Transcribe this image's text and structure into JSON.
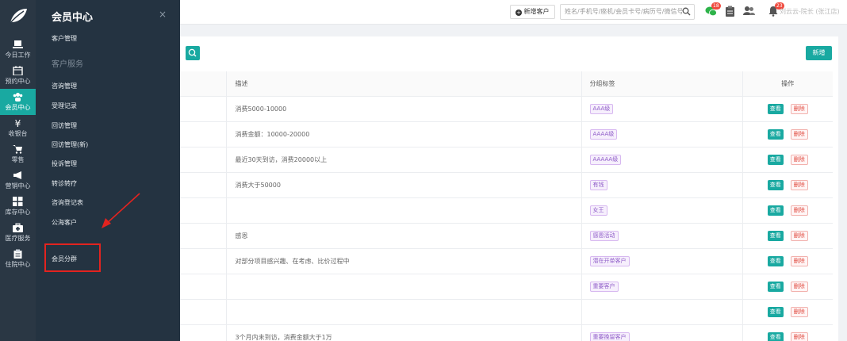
{
  "rail": [
    {
      "label": "今日工作",
      "icon": "laptop-icon"
    },
    {
      "label": "预约中心",
      "icon": "calendar-icon"
    },
    {
      "label": "会员中心",
      "icon": "users-icon",
      "active": true
    },
    {
      "label": "收银台",
      "icon": "yen-icon"
    },
    {
      "label": "零售",
      "icon": "cart-icon"
    },
    {
      "label": "营销中心",
      "icon": "megaphone-icon"
    },
    {
      "label": "库存中心",
      "icon": "grid-icon"
    },
    {
      "label": "医疗服务",
      "icon": "medkit-icon"
    },
    {
      "label": "住院中心",
      "icon": "clipboard-icon"
    }
  ],
  "flyout": {
    "title": "会员中心",
    "close": "×",
    "item_customer_mgmt": "客户管理",
    "section_service": "客户服务",
    "items": [
      "咨询管理",
      "受理记录",
      "回访管理",
      "回访管理(新)",
      "投诉管理",
      "转诊转疗",
      "咨询登记表",
      "公海客户"
    ],
    "item_member_group": "会员分群"
  },
  "header": {
    "add_customer": "新增客户",
    "search_placeholder": "姓名/手机号/座机/会员卡号/病历号/微信号",
    "badge_messages": "18",
    "badge_notifications": "23",
    "user": "刘云云-院长 (张江店)"
  },
  "toolbar": {
    "new_label": "新增"
  },
  "table": {
    "headers": [
      "",
      "描述",
      "分组标签",
      "操作"
    ],
    "rows": [
      {
        "desc": "消费5000-10000",
        "tag": "AAA级"
      },
      {
        "desc": "消费金额：10000-20000",
        "tag": "AAAA级"
      },
      {
        "desc": "最近30天到访，消费20000以上",
        "tag": "AAAAA级"
      },
      {
        "desc": "消费大于50000",
        "tag": "有钱"
      },
      {
        "desc": "",
        "tag": "女王"
      },
      {
        "desc": "感恩",
        "tag": "感恩活动"
      },
      {
        "desc": "对部分项目感兴趣、在考虑、比价过程中",
        "tag": "潜在开单客户"
      },
      {
        "desc": "",
        "tag": "重要客户"
      },
      {
        "desc": "",
        "tag": ""
      },
      {
        "desc": "3个月内未到访，消费金额大于1万",
        "tag": "重要挽留客户"
      }
    ],
    "view_label": "查看",
    "delete_label": "删除"
  },
  "colors": {
    "accent": "#19a9a1",
    "rail_bg": "#2a3744",
    "flyout_bg": "#243341",
    "highlight": "#e3231f"
  }
}
